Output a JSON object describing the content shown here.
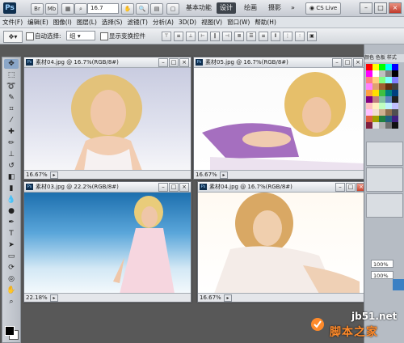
{
  "app": {
    "logo": "Ps",
    "zoom": "16.7",
    "workspaces": [
      "基本功能",
      "设计",
      "绘画",
      "摄影"
    ],
    "active_workspace": "设计",
    "more": "»",
    "cs_live": "CS Live"
  },
  "menu": [
    "文件(F)",
    "编辑(E)",
    "图像(I)",
    "图层(L)",
    "选择(S)",
    "滤镜(T)",
    "分析(A)",
    "3D(D)",
    "视图(V)",
    "窗口(W)",
    "帮助(H)"
  ],
  "options": {
    "auto_select_label": "自动选择:",
    "auto_select_value": "组",
    "show_transform_label": "显示变换控件"
  },
  "documents": [
    {
      "title": "素材04.jpg @ 16.7%(RGB/8#)",
      "zoom": "16.67%"
    },
    {
      "title": "素材05.jpg @ 16.7%(RGB/8#)",
      "zoom": "16.67%"
    },
    {
      "title": "素材03.jpg @ 22.2%(RGB/8#)",
      "zoom": "22.18%"
    },
    {
      "title": "素材04.jpg @ 16.7%(RGB/8#)",
      "zoom": "16.67%"
    }
  ],
  "right_panel": {
    "tabs": "颜色  色板  样式",
    "opacity": "100%",
    "fill": "100%"
  },
  "watermark": {
    "site": "jb51.net",
    "name": "脚本之家"
  },
  "colors": {
    "accent": "#3e444c",
    "swatches": [
      "#ff0000",
      "#ffff00",
      "#00ff00",
      "#00ffff",
      "#0000ff",
      "#ff00ff",
      "#ffffff",
      "#c0c0c0",
      "#808080",
      "#000000",
      "#ff8080",
      "#ffd080",
      "#80ff80",
      "#80ffff",
      "#8080ff",
      "#ff80ff",
      "#e0a070",
      "#a06030",
      "#603010",
      "#404040",
      "#ffa040",
      "#ffe000",
      "#40c040",
      "#008080",
      "#004080",
      "#800080",
      "#c08080",
      "#80c0a0",
      "#6080c0",
      "#202020",
      "#ffc0c0",
      "#fff0c0",
      "#c0ffc0",
      "#c0f0ff",
      "#c0c0ff",
      "#ffc0ff",
      "#f0e0d0",
      "#d0b090",
      "#907050",
      "#505050",
      "#e06040",
      "#a0a000",
      "#208040",
      "#206080",
      "#402080",
      "#802040",
      "#e0e0e0",
      "#b0b0b0",
      "#707070",
      "#101010"
    ]
  }
}
